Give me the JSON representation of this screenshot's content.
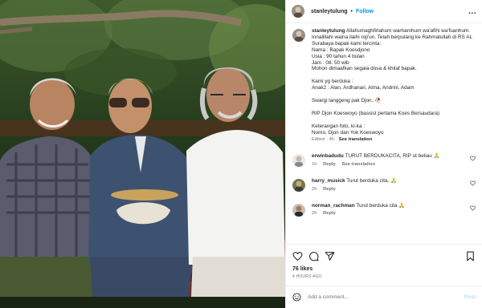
{
  "post": {
    "username": "stanleytulung",
    "follow_label": "Follow",
    "separator": "•",
    "more_label": "...",
    "caption": "Allahumaghfirlahum warhamhum wa'afihi wa'fuanhum. Innalillahi waina ilaihi roji'un. Telah berpulang ke Rahmatullah di RS AL Surabaya bapak kami tercinta:\nNama : Bapak Koesdjono\nUsia : 90 tahun 4 bulan\nJam : 08. 50 wib\nMohon dimaafkan segala dosa & khilaf bapak.\n\nKami yg berduka :\nAnak2 : Alan, Ardhanari, Alma, Andrini, Adam\n\nSwargi langgeng pak Djon..🥀\n\nRIP Djon Koeswoyo (bassist pertama Koes Bersaudara)\n\nKeterangan foto, ki-ka :\nNomo, Djon dan Yok Koeswoyo",
    "edited_label": "Edited · 4h",
    "see_translation": "See translation"
  },
  "comments": [
    {
      "username": "erwinbadudu",
      "text": "TURUT BERDUKACITA, RIP ut beliau 🙏",
      "time": "1h",
      "reply": "Reply",
      "see_translation": "See translation"
    },
    {
      "username": "harry_musick",
      "text": "Turut berduka cita..🙏",
      "time": "2h",
      "reply": "Reply"
    },
    {
      "username": "norman_rachman",
      "text": "Turut berduka cita 🙏",
      "time": "2h",
      "reply": "Reply"
    }
  ],
  "actions": {
    "likes": "76 likes",
    "time_ago": "4 HOURS AGO"
  },
  "add_comment": {
    "placeholder": "Add a comment...",
    "post_label": "Post"
  },
  "colors": {
    "accent": "#0095f6",
    "post_disabled": "#b2dffc"
  },
  "icons": [
    "more-icon",
    "heart-icon",
    "comment-icon",
    "share-icon",
    "save-icon",
    "emoji-icon"
  ]
}
